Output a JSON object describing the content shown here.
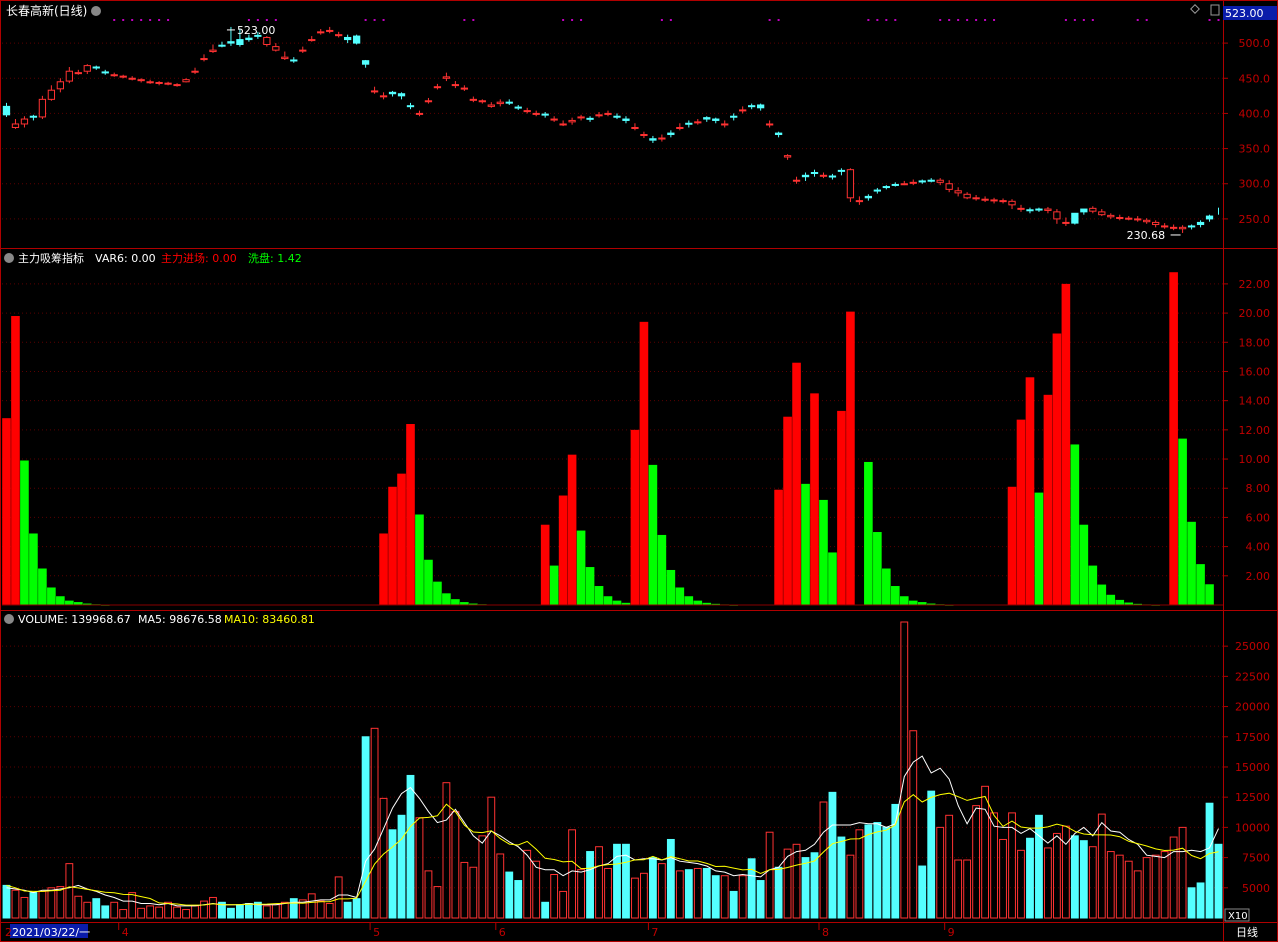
{
  "header": {
    "title": "长春高新(日线)",
    "price_badge": "523.00",
    "period_label": "日线",
    "zoom_label": "X10",
    "date_badge": "2021/03/22/一"
  },
  "panels": {
    "price": {
      "high_label": "523.00",
      "low_label": "230.68"
    },
    "indicator": {
      "name": "主力吸筹指标",
      "var6_label": "VAR6: 0.00",
      "inflow_label": "主力进场: 0.00",
      "washout_label": "洗盘: 1.42"
    },
    "volume": {
      "volume_label": "VOLUME: 139968.67",
      "ma5_label": "MA5: 98676.58",
      "ma10_label": "MA10: 83460.81"
    }
  },
  "colors": {
    "up": "#ff3232",
    "down": "#54ffff",
    "indicator_red": "#ff0000",
    "indicator_green": "#00ff00",
    "ma5": "#ffffff",
    "ma10": "#ffff00",
    "frame": "#b00000",
    "axis_text": "#c00000"
  },
  "chart_data": [
    {
      "type": "candlestick",
      "title": "长春高新(日线)",
      "x_months": [
        "4",
        "5",
        "6",
        "7",
        "8",
        "9"
      ],
      "yticks": [
        250,
        300,
        350,
        400,
        450,
        500
      ],
      "ylim": [
        220,
        530
      ],
      "annotations": [
        {
          "text": "523.00",
          "kind": "high"
        },
        {
          "text": "230.68",
          "kind": "low"
        }
      ],
      "close": [
        398,
        385,
        392,
        395,
        420,
        433,
        445,
        460,
        458,
        468,
        465,
        458,
        455,
        453,
        450,
        448,
        445,
        444,
        443,
        441,
        448,
        460,
        478,
        490,
        496,
        500,
        498,
        505,
        510,
        508,
        495,
        480,
        475,
        490,
        505,
        516,
        518,
        512,
        505,
        500,
        470,
        432,
        425,
        428,
        425,
        410,
        400,
        418,
        438,
        452,
        441,
        436,
        420,
        418,
        412,
        416,
        415,
        408,
        404,
        400,
        398,
        392,
        385,
        390,
        395,
        392,
        398,
        400,
        395,
        390,
        380,
        370,
        362,
        365,
        370,
        380,
        385,
        388,
        392,
        390,
        385,
        395,
        405,
        410,
        408,
        385,
        370,
        340,
        305,
        310,
        315,
        312,
        310,
        318,
        320,
        276,
        280,
        290,
        295,
        298,
        300,
        302,
        303,
        304,
        305,
        300,
        290,
        285,
        280,
        278,
        277,
        276,
        275,
        265,
        262,
        263,
        264,
        260,
        245,
        244,
        260,
        265,
        260,
        255,
        252,
        251,
        250,
        248,
        245,
        240,
        238,
        238,
        239,
        242,
        250,
        262
      ],
      "open": [
        410,
        380,
        385,
        396,
        395,
        420,
        435,
        446,
        458,
        460,
        466,
        459,
        455,
        452,
        450,
        447,
        445,
        443,
        442,
        440,
        445,
        460,
        478,
        488,
        497,
        502,
        505,
        507,
        511,
        498,
        490,
        478,
        476,
        490,
        505,
        515,
        518,
        512,
        508,
        510,
        475,
        432,
        424,
        430,
        428,
        411,
        400,
        418,
        438,
        450,
        440,
        435,
        419,
        417,
        410,
        414,
        416,
        409,
        404,
        400,
        399,
        392,
        385,
        388,
        394,
        393,
        398,
        400,
        396,
        392,
        380,
        370,
        364,
        365,
        372,
        380,
        386,
        388,
        394,
        392,
        385,
        396,
        405,
        411,
        412,
        385,
        372,
        338,
        305,
        312,
        316,
        312,
        311,
        319,
        280,
        275,
        282,
        291,
        296,
        299,
        300,
        302,
        304,
        305,
        302,
        292,
        287,
        280,
        279,
        277,
        276,
        275,
        270,
        264,
        263,
        264,
        262,
        250,
        245,
        258,
        264,
        261,
        256,
        253,
        252,
        251,
        249,
        246,
        242,
        240,
        238,
        236,
        240,
        245,
        254
      ],
      "high": [
        415,
        392,
        396,
        398,
        425,
        440,
        450,
        466,
        462,
        470,
        468,
        462,
        458,
        455,
        453,
        450,
        448,
        446,
        445,
        443,
        450,
        465,
        484,
        498,
        502,
        523,
        520,
        512,
        516,
        510,
        500,
        488,
        480,
        495,
        510,
        520,
        523,
        516,
        512,
        512,
        476,
        438,
        430,
        432,
        430,
        415,
        404,
        422,
        442,
        458,
        446,
        440,
        424,
        420,
        416,
        420,
        420,
        412,
        408,
        404,
        402,
        396,
        390,
        394,
        398,
        396,
        402,
        404,
        400,
        396,
        386,
        374,
        368,
        370,
        376,
        386,
        390,
        392,
        396,
        394,
        390,
        400,
        410,
        414,
        414,
        390,
        374,
        342,
        310,
        316,
        320,
        316,
        314,
        322,
        322,
        282,
        285,
        294,
        298,
        302,
        304,
        306,
        306,
        308,
        308,
        305,
        295,
        288,
        284,
        282,
        280,
        279,
        278,
        270,
        266,
        266,
        267,
        264,
        252,
        248,
        264,
        268,
        264,
        258,
        256,
        254,
        254,
        251,
        248,
        244,
        242,
        241,
        242,
        248,
        256,
        266
      ],
      "low": [
        395,
        378,
        380,
        390,
        392,
        418,
        430,
        443,
        455,
        456,
        462,
        455,
        452,
        450,
        447,
        444,
        442,
        440,
        440,
        438,
        444,
        456,
        474,
        486,
        494,
        496,
        495,
        502,
        506,
        495,
        488,
        476,
        472,
        486,
        502,
        512,
        514,
        508,
        500,
        498,
        465,
        428,
        420,
        424,
        420,
        406,
        396,
        414,
        434,
        446,
        436,
        432,
        416,
        414,
        408,
        410,
        412,
        405,
        400,
        396,
        394,
        388,
        382,
        384,
        390,
        388,
        394,
        396,
        392,
        386,
        376,
        365,
        358,
        360,
        366,
        376,
        380,
        384,
        388,
        386,
        380,
        390,
        400,
        406,
        404,
        380,
        366,
        334,
        300,
        304,
        310,
        308,
        306,
        312,
        274,
        270,
        276,
        286,
        292,
        296,
        298,
        298,
        300,
        302,
        298,
        288,
        282,
        278,
        276,
        274,
        272,
        272,
        264,
        260,
        258,
        260,
        258,
        243,
        240,
        242,
        256,
        258,
        254,
        250,
        248,
        248,
        246,
        243,
        238,
        236,
        234,
        230,
        235,
        238,
        246,
        256
      ]
    },
    {
      "type": "bar",
      "title": "主力吸筹指标",
      "series": [
        {
          "name": "主力进场",
          "values": [
            12.8,
            19.8,
            0,
            0,
            0,
            0,
            0,
            0,
            0,
            0,
            0,
            0,
            0,
            0,
            0,
            0,
            0,
            0,
            0,
            0,
            0,
            0,
            0,
            0,
            0,
            0,
            0,
            0,
            0,
            0,
            0,
            0,
            0,
            0,
            0,
            0,
            0,
            0,
            0,
            0,
            0,
            0,
            4.9,
            8.1,
            9.0,
            12.4,
            0,
            0,
            0,
            0,
            0,
            0,
            0,
            0,
            0,
            0,
            0,
            0,
            0,
            0,
            5.5,
            0,
            7.5,
            10.3,
            0,
            0,
            0,
            0,
            0,
            0,
            12.0,
            19.4,
            0,
            0,
            0,
            0,
            0,
            0,
            0,
            0,
            0,
            0,
            0,
            0,
            0,
            0,
            7.9,
            12.9,
            16.6,
            0,
            14.5,
            0,
            0,
            13.3,
            20.1,
            0,
            0,
            0,
            0,
            0,
            0,
            0,
            0,
            0,
            0,
            0,
            0,
            0,
            0,
            0,
            0,
            0,
            8.1,
            12.7,
            15.6,
            0,
            14.4,
            18.6,
            22.0,
            0,
            0,
            0,
            0,
            0,
            0,
            0,
            0,
            0,
            0,
            0,
            22.8,
            0,
            0,
            0,
            0
          ]
        },
        {
          "name": "洗盘",
          "values": [
            0,
            0,
            9.9,
            4.9,
            2.5,
            1.2,
            0.6,
            0.3,
            0.2,
            0.1,
            0.05,
            0.02,
            0,
            0,
            0,
            0,
            0,
            0,
            0,
            0,
            0,
            0,
            0,
            0,
            0,
            0,
            0,
            0,
            0,
            0,
            0,
            0,
            0,
            0,
            0,
            0,
            0,
            0,
            0,
            0,
            0,
            0,
            0,
            0,
            4.1,
            0,
            6.2,
            3.1,
            1.6,
            0.8,
            0.4,
            0.2,
            0.1,
            0.05,
            0,
            0,
            0,
            0,
            0,
            0,
            0,
            2.7,
            0,
            0,
            5.1,
            2.6,
            1.3,
            0.6,
            0.3,
            0.15,
            0,
            0,
            9.6,
            4.8,
            2.4,
            1.2,
            0.6,
            0.3,
            0.15,
            0.08,
            0.04,
            0.02,
            0,
            0,
            0,
            0,
            0,
            0,
            0,
            8.3,
            0,
            7.2,
            3.6,
            1.8,
            0,
            0,
            9.8,
            5.0,
            2.5,
            1.3,
            0.6,
            0.3,
            0.2,
            0.1,
            0.05,
            0.02,
            0,
            0,
            0,
            0,
            0,
            0,
            0,
            0,
            0,
            7.7,
            0,
            0,
            0,
            11.0,
            5.5,
            2.7,
            1.4,
            0.7,
            0.35,
            0.17,
            0.08,
            0.04,
            0.02,
            0,
            0,
            11.4,
            5.7,
            2.8,
            1.42
          ]
        }
      ],
      "yticks": [
        2,
        4,
        6,
        8,
        10,
        12,
        14,
        16,
        18,
        20,
        22
      ],
      "ylim": [
        0,
        23.5
      ]
    },
    {
      "type": "bar",
      "title": "VOLUME",
      "unit_multiplier": "X10",
      "yticks": [
        5000,
        7500,
        10000,
        12500,
        15000,
        17500,
        20000,
        22500,
        25000
      ],
      "ylim": [
        2500,
        27000
      ],
      "volume": [
        5200,
        4800,
        4200,
        4600,
        4700,
        5000,
        5100,
        7000,
        4300,
        3800,
        4100,
        3500,
        3800,
        3200,
        4600,
        3300,
        3500,
        3400,
        3800,
        3400,
        3200,
        3500,
        3900,
        4200,
        3800,
        3300,
        3600,
        3700,
        3800,
        3500,
        3600,
        3800,
        4100,
        4000,
        4500,
        3900,
        3700,
        5900,
        3800,
        4100,
        17500,
        18200,
        12400,
        9800,
        11000,
        14300,
        10800,
        6400,
        5100,
        13700,
        11300,
        7100,
        6700,
        9300,
        12500,
        7800,
        6300,
        5600,
        8100,
        7200,
        3800,
        6100,
        4700,
        9800,
        6500,
        8000,
        8400,
        6600,
        8600,
        8600,
        5800,
        6200,
        7500,
        7000,
        9000,
        6400,
        6500,
        6600,
        6600,
        6000,
        6000,
        4700,
        6000,
        7400,
        5600,
        9600,
        6700,
        8200,
        8600,
        7500,
        7900,
        12100,
        12900,
        9200,
        7700,
        9800,
        10200,
        10400,
        10000,
        11900,
        27000,
        18000,
        6800,
        13000,
        10000,
        11000,
        7300,
        7300,
        11800,
        13400,
        11200,
        9000,
        11200,
        8100,
        9100,
        11000,
        8300,
        9500,
        10100,
        9300,
        8900,
        8400,
        11100,
        8000,
        7700,
        7200,
        6400,
        7500,
        7700,
        8000,
        9200,
        10000,
        5000,
        5400,
        12000,
        8600,
        9100,
        14500
      ],
      "ma5": [
        5000,
        4900,
        4800,
        4600,
        4800,
        4800,
        4900,
        5000,
        5200,
        4900,
        4700,
        4400,
        4200,
        3900,
        3900,
        3700,
        3700,
        3600,
        3700,
        3500,
        3500,
        3500,
        3600,
        3700,
        3600,
        3600,
        3600,
        3700,
        3600,
        3600,
        3600,
        3700,
        3800,
        3800,
        3900,
        4000,
        4000,
        4400,
        4400,
        4200,
        7200,
        8200,
        9900,
        11600,
        12800,
        13300,
        12400,
        11300,
        10400,
        10600,
        11500,
        10400,
        9300,
        8700,
        9700,
        9300,
        8800,
        8400,
        7700,
        6700,
        6500,
        6500,
        6000,
        6400,
        6300,
        6500,
        6800,
        7000,
        7600,
        7700,
        7300,
        7400,
        7400,
        7300,
        7500,
        7200,
        7100,
        7000,
        6800,
        6400,
        6300,
        6000,
        6100,
        6000,
        5900,
        6500,
        6700,
        7600,
        8000,
        8100,
        8600,
        9600,
        10200,
        10200,
        10200,
        10400,
        10300,
        10300,
        10000,
        10300,
        14200,
        15400,
        15900,
        14500,
        14900,
        14000,
        11800,
        10300,
        11600,
        11500,
        10100,
        10000,
        10000,
        9500,
        9900,
        9300,
        8700,
        9300,
        8600,
        9500,
        10000,
        9300,
        10400,
        9700,
        9600,
        9000,
        8600,
        7700,
        7600,
        7500,
        8000,
        8000,
        8100,
        8000,
        8300,
        9900
      ]
    }
  ]
}
